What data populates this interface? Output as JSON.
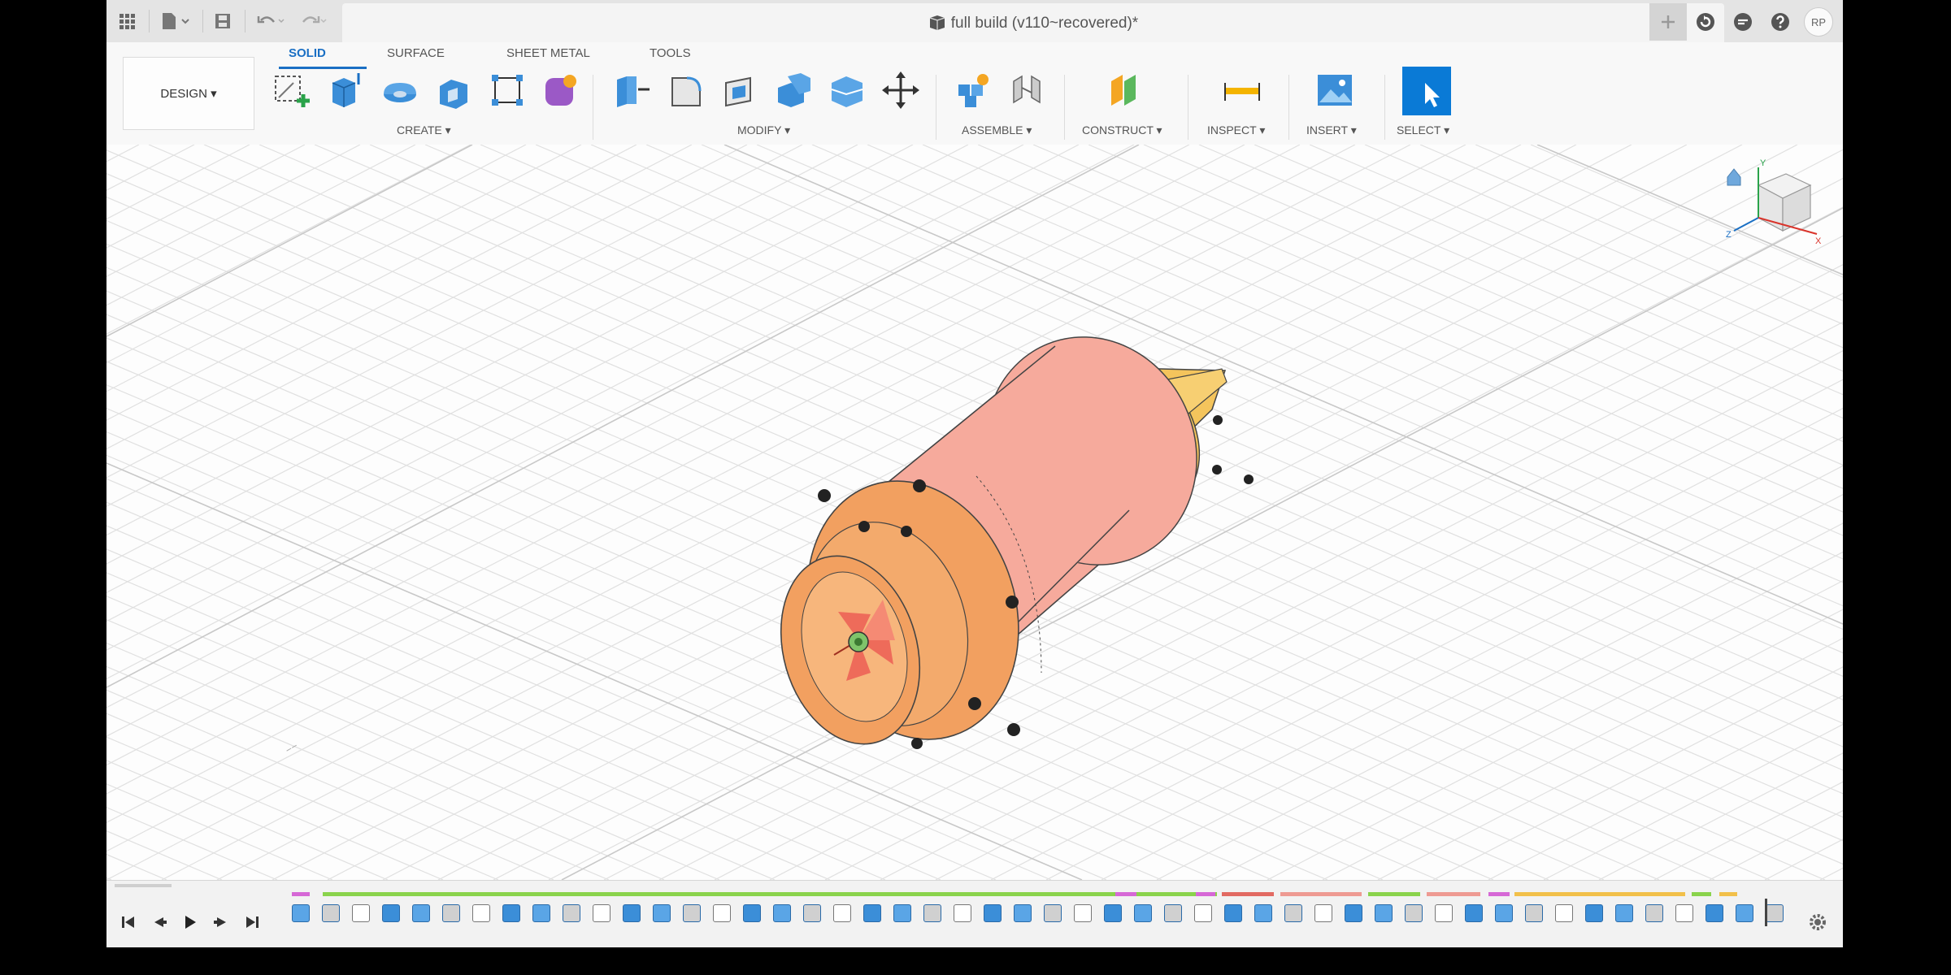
{
  "window": {
    "title": "full build (v110~recovered)*",
    "close_glyph": "×",
    "avatar_initials": "RP"
  },
  "titlebar_icons": [
    "grid-menu-icon",
    "file-icon",
    "save-icon",
    "undo-icon",
    "redo-icon"
  ],
  "right_icons": [
    "add-tab-icon",
    "refresh-icon",
    "notifications-icon",
    "help-icon"
  ],
  "workspace": {
    "label": "DESIGN ▾"
  },
  "tabs": [
    {
      "label": "SOLID",
      "active": true
    },
    {
      "label": "SURFACE",
      "active": false
    },
    {
      "label": "SHEET METAL",
      "active": false
    },
    {
      "label": "TOOLS",
      "active": false
    }
  ],
  "groups": {
    "create": "CREATE ▾",
    "modify": "MODIFY ▾",
    "assemble": "ASSEMBLE ▾",
    "construct": "CONSTRUCT ▾",
    "inspect": "INSPECT ▾",
    "insert": "INSERT ▾",
    "select": "SELECT ▾"
  },
  "tools": {
    "create": [
      "create-sketch-icon",
      "extrude-icon",
      "revolve-icon",
      "sweep-icon",
      "rectangular-pattern-icon",
      "form-icon"
    ],
    "modify": [
      "press-pull-icon",
      "fillet-icon",
      "shell-icon",
      "combine-icon",
      "offset-face-icon",
      "move-icon"
    ],
    "assemble": [
      "new-component-icon",
      "joint-icon"
    ],
    "construct": [
      "offset-plane-icon"
    ],
    "inspect": [
      "measure-icon"
    ],
    "insert": [
      "insert-image-icon"
    ],
    "select": [
      "select-cursor-icon"
    ]
  },
  "viewcube": {
    "axis_x": "X",
    "axis_y": "Y",
    "axis_z": "Z"
  },
  "colors": {
    "accent": "#1a6fc4",
    "body_pink": "#f6aa9c",
    "flange_orange": "#f2a060",
    "cone_yellow": "#f4c45c",
    "grid": "#dcdcdc"
  },
  "timeline": {
    "controls": [
      "skip-to-start-icon",
      "step-back-icon",
      "play-icon",
      "step-forward-icon",
      "skip-to-end-icon"
    ],
    "settings_icon": "gear-icon"
  }
}
